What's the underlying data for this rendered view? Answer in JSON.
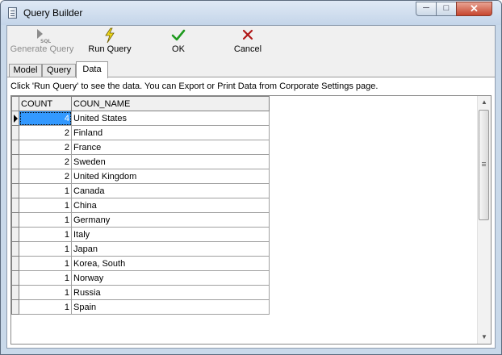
{
  "window": {
    "title": "Query Builder",
    "controls": {
      "minimize": "─",
      "maximize": "□",
      "close": "✕"
    }
  },
  "toolbar": {
    "generate_query": {
      "label": "Generate Query",
      "icon": "generate-sql-icon",
      "enabled": false
    },
    "run_query": {
      "label": "Run Query",
      "icon": "lightning-icon",
      "enabled": true
    },
    "ok": {
      "label": "OK",
      "icon": "checkmark-icon",
      "enabled": true
    },
    "cancel": {
      "label": "Cancel",
      "icon": "x-icon",
      "enabled": true
    }
  },
  "tabs": [
    {
      "label": "Model",
      "active": false
    },
    {
      "label": "Query",
      "active": false
    },
    {
      "label": "Data",
      "active": true
    }
  ],
  "hint": "Click 'Run Query' to see the data. You can Export or Print Data from Corporate Settings page.",
  "grid": {
    "columns": [
      "COUNT",
      "COUN_NAME"
    ],
    "rows": [
      {
        "count": "4",
        "name": "United States"
      },
      {
        "count": "2",
        "name": "Finland"
      },
      {
        "count": "2",
        "name": "France"
      },
      {
        "count": "2",
        "name": "Sweden"
      },
      {
        "count": "2",
        "name": "United Kingdom"
      },
      {
        "count": "1",
        "name": "Canada"
      },
      {
        "count": "1",
        "name": "China"
      },
      {
        "count": "1",
        "name": "Germany"
      },
      {
        "count": "1",
        "name": "Italy"
      },
      {
        "count": "1",
        "name": "Japan"
      },
      {
        "count": "1",
        "name": "Korea, South"
      },
      {
        "count": "1",
        "name": "Norway"
      },
      {
        "count": "1",
        "name": "Russia"
      },
      {
        "count": "1",
        "name": "Spain"
      }
    ],
    "selected_row": 0
  },
  "colors": {
    "selection": "#3399ff",
    "lightning": "#e8d000",
    "check": "#1f9a1f",
    "cancel": "#b01818"
  }
}
